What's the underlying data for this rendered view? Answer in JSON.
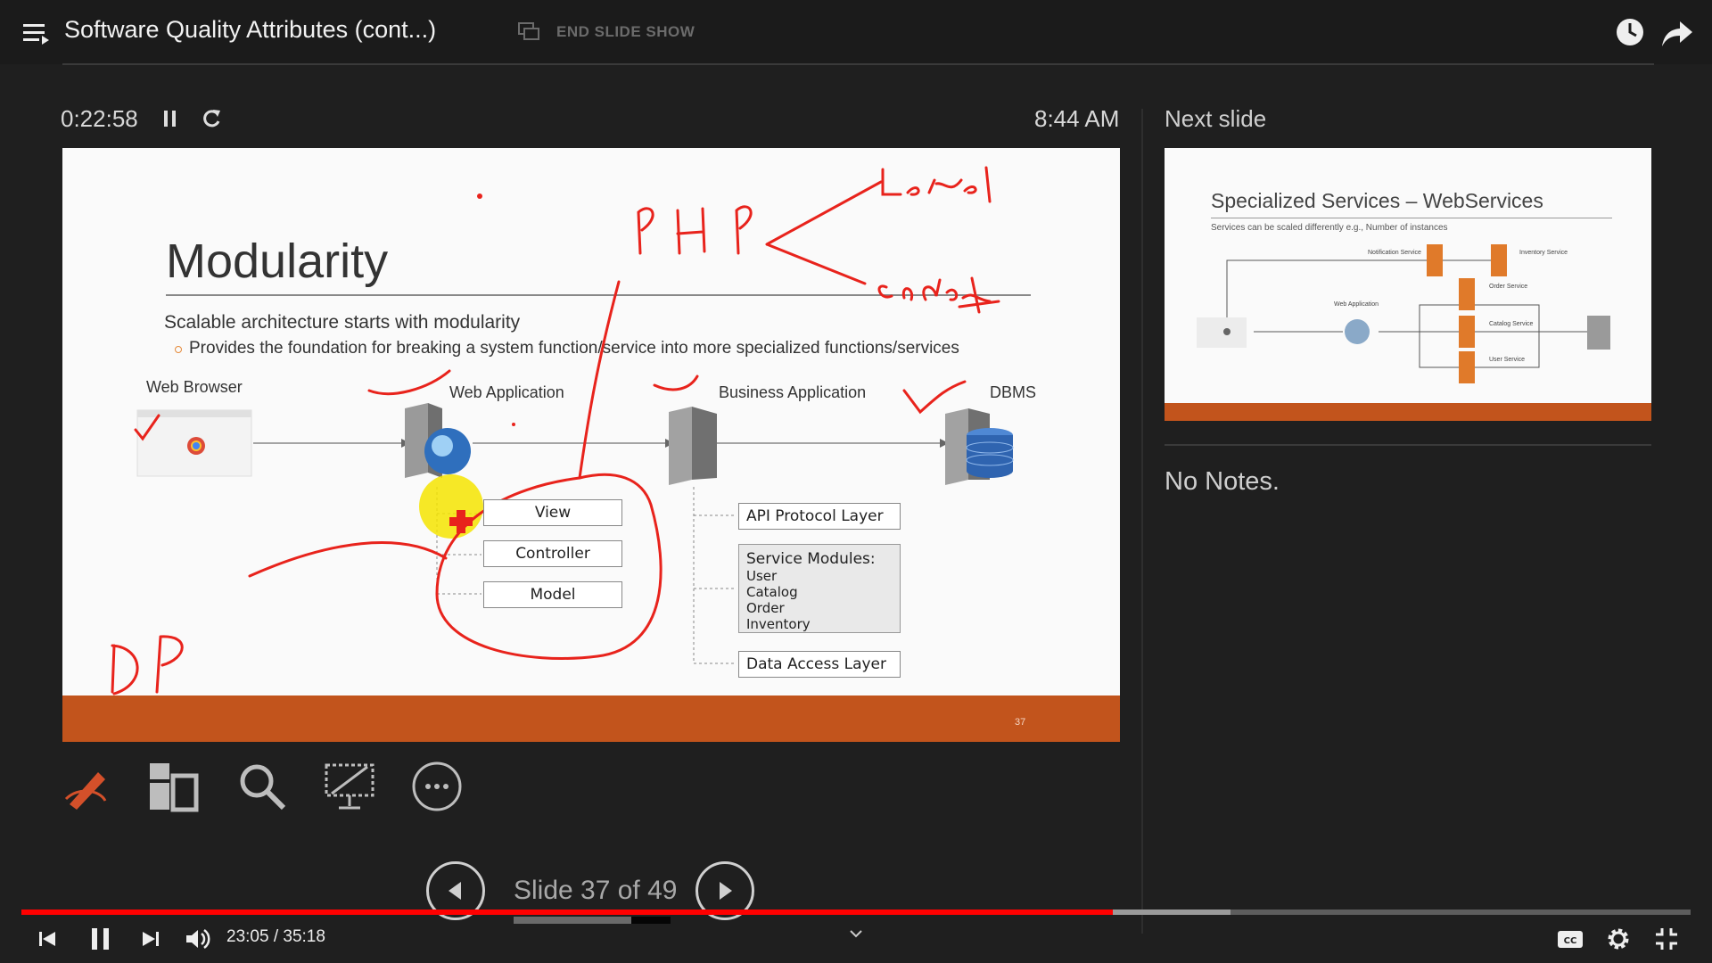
{
  "video": {
    "title": "Software Quality Attributes (cont...)",
    "time_current": "23:05",
    "time_total": "35:18",
    "time_display": "23:05 / 35:18",
    "progress_fraction": 0.654
  },
  "presenter": {
    "end_slide_show": "END SLIDE SHOW",
    "timer": "0:22:58",
    "clock": "8:44 AM",
    "next_slide_label": "Next slide",
    "notes": "No Notes.",
    "slide_counter": "Slide 37 of 49"
  },
  "slide": {
    "title": "Modularity",
    "subtitle": "Scalable architecture starts with modularity",
    "bullet": "Provides the foundation for breaking a system function/service into more specialized functions/services",
    "labels": {
      "web_browser": "Web Browser",
      "web_application": "Web Application",
      "business_application": "Business Application",
      "dbms": "DBMS"
    },
    "mvc": [
      "View",
      "Controller",
      "Model"
    ],
    "api_layer": "API Protocol Layer",
    "service_modules_title": "Service Modules:",
    "service_modules": [
      "User",
      "Catalog",
      "Order",
      "Inventory"
    ],
    "data_access_layer": "Data Access Layer",
    "page_number": "37",
    "annotations": {
      "php": "PHP",
      "laravel": "Laravel",
      "codei": "CodeI",
      "dp": "DP"
    }
  },
  "next_slide": {
    "title": "Specialized Services – WebServices",
    "subtitle": "Services can be scaled differently e.g., Number of instances",
    "labels": [
      "Notification Service",
      "Inventory Service",
      "Order Service",
      "Web Application",
      "Catalog Service",
      "User Service"
    ]
  },
  "colors": {
    "accent_orange": "#c2541c",
    "annotation_red": "#e8231c",
    "progress_red": "#ff0000",
    "background": "#1f1f1f"
  }
}
